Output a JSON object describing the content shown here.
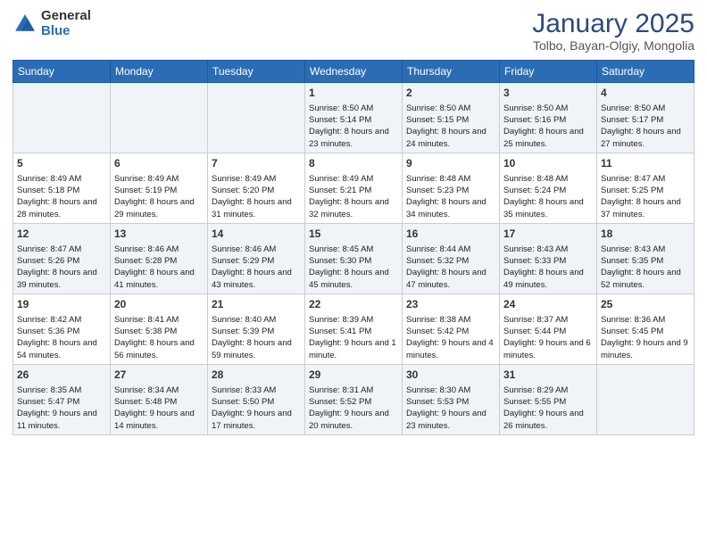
{
  "header": {
    "logo_general": "General",
    "logo_blue": "Blue",
    "title": "January 2025",
    "subtitle": "Tolbo, Bayan-Olgiy, Mongolia"
  },
  "columns": [
    "Sunday",
    "Monday",
    "Tuesday",
    "Wednesday",
    "Thursday",
    "Friday",
    "Saturday"
  ],
  "weeks": [
    {
      "row_bg": "light",
      "cells": [
        {
          "day": "",
          "text": ""
        },
        {
          "day": "",
          "text": ""
        },
        {
          "day": "",
          "text": ""
        },
        {
          "day": "1",
          "text": "Sunrise: 8:50 AM\nSunset: 5:14 PM\nDaylight: 8 hours and 23 minutes."
        },
        {
          "day": "2",
          "text": "Sunrise: 8:50 AM\nSunset: 5:15 PM\nDaylight: 8 hours and 24 minutes."
        },
        {
          "day": "3",
          "text": "Sunrise: 8:50 AM\nSunset: 5:16 PM\nDaylight: 8 hours and 25 minutes."
        },
        {
          "day": "4",
          "text": "Sunrise: 8:50 AM\nSunset: 5:17 PM\nDaylight: 8 hours and 27 minutes."
        }
      ]
    },
    {
      "row_bg": "dark",
      "cells": [
        {
          "day": "5",
          "text": "Sunrise: 8:49 AM\nSunset: 5:18 PM\nDaylight: 8 hours and 28 minutes."
        },
        {
          "day": "6",
          "text": "Sunrise: 8:49 AM\nSunset: 5:19 PM\nDaylight: 8 hours and 29 minutes."
        },
        {
          "day": "7",
          "text": "Sunrise: 8:49 AM\nSunset: 5:20 PM\nDaylight: 8 hours and 31 minutes."
        },
        {
          "day": "8",
          "text": "Sunrise: 8:49 AM\nSunset: 5:21 PM\nDaylight: 8 hours and 32 minutes."
        },
        {
          "day": "9",
          "text": "Sunrise: 8:48 AM\nSunset: 5:23 PM\nDaylight: 8 hours and 34 minutes."
        },
        {
          "day": "10",
          "text": "Sunrise: 8:48 AM\nSunset: 5:24 PM\nDaylight: 8 hours and 35 minutes."
        },
        {
          "day": "11",
          "text": "Sunrise: 8:47 AM\nSunset: 5:25 PM\nDaylight: 8 hours and 37 minutes."
        }
      ]
    },
    {
      "row_bg": "light",
      "cells": [
        {
          "day": "12",
          "text": "Sunrise: 8:47 AM\nSunset: 5:26 PM\nDaylight: 8 hours and 39 minutes."
        },
        {
          "day": "13",
          "text": "Sunrise: 8:46 AM\nSunset: 5:28 PM\nDaylight: 8 hours and 41 minutes."
        },
        {
          "day": "14",
          "text": "Sunrise: 8:46 AM\nSunset: 5:29 PM\nDaylight: 8 hours and 43 minutes."
        },
        {
          "day": "15",
          "text": "Sunrise: 8:45 AM\nSunset: 5:30 PM\nDaylight: 8 hours and 45 minutes."
        },
        {
          "day": "16",
          "text": "Sunrise: 8:44 AM\nSunset: 5:32 PM\nDaylight: 8 hours and 47 minutes."
        },
        {
          "day": "17",
          "text": "Sunrise: 8:43 AM\nSunset: 5:33 PM\nDaylight: 8 hours and 49 minutes."
        },
        {
          "day": "18",
          "text": "Sunrise: 8:43 AM\nSunset: 5:35 PM\nDaylight: 8 hours and 52 minutes."
        }
      ]
    },
    {
      "row_bg": "dark",
      "cells": [
        {
          "day": "19",
          "text": "Sunrise: 8:42 AM\nSunset: 5:36 PM\nDaylight: 8 hours and 54 minutes."
        },
        {
          "day": "20",
          "text": "Sunrise: 8:41 AM\nSunset: 5:38 PM\nDaylight: 8 hours and 56 minutes."
        },
        {
          "day": "21",
          "text": "Sunrise: 8:40 AM\nSunset: 5:39 PM\nDaylight: 8 hours and 59 minutes."
        },
        {
          "day": "22",
          "text": "Sunrise: 8:39 AM\nSunset: 5:41 PM\nDaylight: 9 hours and 1 minute."
        },
        {
          "day": "23",
          "text": "Sunrise: 8:38 AM\nSunset: 5:42 PM\nDaylight: 9 hours and 4 minutes."
        },
        {
          "day": "24",
          "text": "Sunrise: 8:37 AM\nSunset: 5:44 PM\nDaylight: 9 hours and 6 minutes."
        },
        {
          "day": "25",
          "text": "Sunrise: 8:36 AM\nSunset: 5:45 PM\nDaylight: 9 hours and 9 minutes."
        }
      ]
    },
    {
      "row_bg": "light",
      "cells": [
        {
          "day": "26",
          "text": "Sunrise: 8:35 AM\nSunset: 5:47 PM\nDaylight: 9 hours and 11 minutes."
        },
        {
          "day": "27",
          "text": "Sunrise: 8:34 AM\nSunset: 5:48 PM\nDaylight: 9 hours and 14 minutes."
        },
        {
          "day": "28",
          "text": "Sunrise: 8:33 AM\nSunset: 5:50 PM\nDaylight: 9 hours and 17 minutes."
        },
        {
          "day": "29",
          "text": "Sunrise: 8:31 AM\nSunset: 5:52 PM\nDaylight: 9 hours and 20 minutes."
        },
        {
          "day": "30",
          "text": "Sunrise: 8:30 AM\nSunset: 5:53 PM\nDaylight: 9 hours and 23 minutes."
        },
        {
          "day": "31",
          "text": "Sunrise: 8:29 AM\nSunset: 5:55 PM\nDaylight: 9 hours and 26 minutes."
        },
        {
          "day": "",
          "text": ""
        }
      ]
    }
  ]
}
